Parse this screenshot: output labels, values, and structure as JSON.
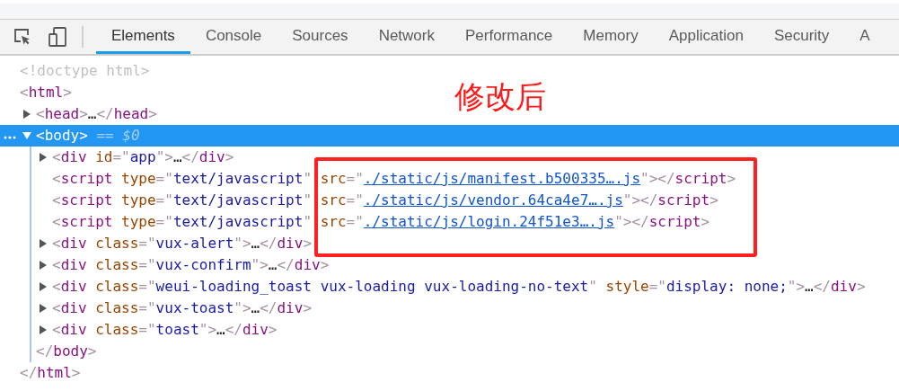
{
  "toolbar": {
    "tabs": [
      {
        "label": "Elements",
        "selected": true
      },
      {
        "label": "Console",
        "selected": false
      },
      {
        "label": "Sources",
        "selected": false
      },
      {
        "label": "Network",
        "selected": false
      },
      {
        "label": "Performance",
        "selected": false
      },
      {
        "label": "Memory",
        "selected": false
      },
      {
        "label": "Application",
        "selected": false
      },
      {
        "label": "Security",
        "selected": false
      },
      {
        "label": "A",
        "selected": false
      }
    ]
  },
  "annotation": "修改后",
  "dom_tree": [
    {
      "kind": "leaf",
      "selected": false,
      "tokens": [
        {
          "kind": "doctype",
          "text": "<!doctype html>"
        }
      ]
    },
    {
      "kind": "leaf",
      "selected": false,
      "tokens": [
        {
          "kind": "bracket",
          "text": "<"
        },
        {
          "kind": "tag",
          "text": "html"
        },
        {
          "kind": "bracket",
          "text": ">"
        }
      ],
      "close": [
        {
          "kind": "bracket",
          "text": "</"
        },
        {
          "kind": "tag",
          "text": "html"
        },
        {
          "kind": "bracket",
          "text": ">"
        }
      ],
      "children": [
        {
          "kind": "branch",
          "expanded": false,
          "selected": false,
          "tokens": [
            {
              "kind": "bracket",
              "text": "<"
            },
            {
              "kind": "tag",
              "text": "head"
            },
            {
              "kind": "bracket",
              "text": ">"
            },
            {
              "kind": "plain",
              "text": "…"
            },
            {
              "kind": "bracket",
              "text": "</"
            },
            {
              "kind": "tag",
              "text": "head"
            },
            {
              "kind": "bracket",
              "text": ">"
            }
          ]
        },
        {
          "kind": "branch",
          "expanded": true,
          "selected": true,
          "tokens": [
            {
              "kind": "bracket",
              "text": "<"
            },
            {
              "kind": "tag",
              "text": "body"
            },
            {
              "kind": "bracket",
              "text": ">"
            },
            {
              "kind": "note",
              "text": " == "
            },
            {
              "kind": "var",
              "text": "$0"
            }
          ],
          "close": [
            {
              "kind": "bracket",
              "text": "</"
            },
            {
              "kind": "tag",
              "text": "body"
            },
            {
              "kind": "bracket",
              "text": ">"
            }
          ],
          "children": [
            {
              "kind": "branch",
              "expanded": false,
              "selected": false,
              "tokens": [
                {
                  "kind": "bracket",
                  "text": "<"
                },
                {
                  "kind": "tag",
                  "text": "div"
                },
                {
                  "kind": "attr",
                  "text": " id"
                },
                {
                  "kind": "bracket",
                  "text": "=\""
                },
                {
                  "kind": "value",
                  "text": "app"
                },
                {
                  "kind": "bracket",
                  "text": "\">"
                },
                {
                  "kind": "plain",
                  "text": "…"
                },
                {
                  "kind": "bracket",
                  "text": "</"
                },
                {
                  "kind": "tag",
                  "text": "div"
                },
                {
                  "kind": "bracket",
                  "text": ">"
                }
              ]
            },
            {
              "kind": "leaf",
              "selected": false,
              "tokens": [
                {
                  "kind": "bracket",
                  "text": "<"
                },
                {
                  "kind": "tag",
                  "text": "script"
                },
                {
                  "kind": "attr",
                  "text": " type"
                },
                {
                  "kind": "bracket",
                  "text": "=\""
                },
                {
                  "kind": "value",
                  "text": "text/javascript"
                },
                {
                  "kind": "bracket",
                  "text": "\""
                },
                {
                  "kind": "attr",
                  "text": " src"
                },
                {
                  "kind": "bracket",
                  "text": "=\""
                },
                {
                  "kind": "link",
                  "text": "./static/js/manifest.b500335….js"
                },
                {
                  "kind": "bracket",
                  "text": "\"></"
                },
                {
                  "kind": "tag",
                  "text": "script"
                },
                {
                  "kind": "bracket",
                  "text": ">"
                }
              ]
            },
            {
              "kind": "leaf",
              "selected": false,
              "tokens": [
                {
                  "kind": "bracket",
                  "text": "<"
                },
                {
                  "kind": "tag",
                  "text": "script"
                },
                {
                  "kind": "attr",
                  "text": " type"
                },
                {
                  "kind": "bracket",
                  "text": "=\""
                },
                {
                  "kind": "value",
                  "text": "text/javascript"
                },
                {
                  "kind": "bracket",
                  "text": "\""
                },
                {
                  "kind": "attr",
                  "text": " src"
                },
                {
                  "kind": "bracket",
                  "text": "=\""
                },
                {
                  "kind": "link",
                  "text": "./static/js/vendor.64ca4e7….js"
                },
                {
                  "kind": "bracket",
                  "text": "\"></"
                },
                {
                  "kind": "tag",
                  "text": "script"
                },
                {
                  "kind": "bracket",
                  "text": ">"
                }
              ]
            },
            {
              "kind": "leaf",
              "selected": false,
              "tokens": [
                {
                  "kind": "bracket",
                  "text": "<"
                },
                {
                  "kind": "tag",
                  "text": "script"
                },
                {
                  "kind": "attr",
                  "text": " type"
                },
                {
                  "kind": "bracket",
                  "text": "=\""
                },
                {
                  "kind": "value",
                  "text": "text/javascript"
                },
                {
                  "kind": "bracket",
                  "text": "\""
                },
                {
                  "kind": "attr",
                  "text": " src"
                },
                {
                  "kind": "bracket",
                  "text": "=\""
                },
                {
                  "kind": "link",
                  "text": "./static/js/login.24f51e3….js"
                },
                {
                  "kind": "bracket",
                  "text": "\"></"
                },
                {
                  "kind": "tag",
                  "text": "script"
                },
                {
                  "kind": "bracket",
                  "text": ">"
                }
              ]
            },
            {
              "kind": "branch",
              "expanded": false,
              "selected": false,
              "tokens": [
                {
                  "kind": "bracket",
                  "text": "<"
                },
                {
                  "kind": "tag",
                  "text": "div"
                },
                {
                  "kind": "attr",
                  "text": " class"
                },
                {
                  "kind": "bracket",
                  "text": "=\""
                },
                {
                  "kind": "value",
                  "text": "vux-alert"
                },
                {
                  "kind": "bracket",
                  "text": "\">"
                },
                {
                  "kind": "plain",
                  "text": "…"
                },
                {
                  "kind": "bracket",
                  "text": "</"
                },
                {
                  "kind": "tag",
                  "text": "div"
                },
                {
                  "kind": "bracket",
                  "text": ">"
                }
              ]
            },
            {
              "kind": "branch",
              "expanded": false,
              "selected": false,
              "tokens": [
                {
                  "kind": "bracket",
                  "text": "<"
                },
                {
                  "kind": "tag",
                  "text": "div"
                },
                {
                  "kind": "attr",
                  "text": " class"
                },
                {
                  "kind": "bracket",
                  "text": "=\""
                },
                {
                  "kind": "value",
                  "text": "vux-confirm"
                },
                {
                  "kind": "bracket",
                  "text": "\">"
                },
                {
                  "kind": "plain",
                  "text": "…"
                },
                {
                  "kind": "bracket",
                  "text": "</"
                },
                {
                  "kind": "tag",
                  "text": "div"
                },
                {
                  "kind": "bracket",
                  "text": ">"
                }
              ]
            },
            {
              "kind": "branch",
              "expanded": false,
              "selected": false,
              "tokens": [
                {
                  "kind": "bracket",
                  "text": "<"
                },
                {
                  "kind": "tag",
                  "text": "div"
                },
                {
                  "kind": "attr",
                  "text": " class"
                },
                {
                  "kind": "bracket",
                  "text": "=\""
                },
                {
                  "kind": "value",
                  "text": "weui-loading_toast vux-loading vux-loading-no-text"
                },
                {
                  "kind": "bracket",
                  "text": "\""
                },
                {
                  "kind": "attr",
                  "text": " style"
                },
                {
                  "kind": "bracket",
                  "text": "=\""
                },
                {
                  "kind": "value",
                  "text": "display: none;"
                },
                {
                  "kind": "bracket",
                  "text": "\">"
                },
                {
                  "kind": "plain",
                  "text": "…"
                },
                {
                  "kind": "bracket",
                  "text": "</"
                },
                {
                  "kind": "tag",
                  "text": "div"
                },
                {
                  "kind": "bracket",
                  "text": ">"
                }
              ]
            },
            {
              "kind": "branch",
              "expanded": false,
              "selected": false,
              "tokens": [
                {
                  "kind": "bracket",
                  "text": "<"
                },
                {
                  "kind": "tag",
                  "text": "div"
                },
                {
                  "kind": "attr",
                  "text": " class"
                },
                {
                  "kind": "bracket",
                  "text": "=\""
                },
                {
                  "kind": "value",
                  "text": "vux-toast"
                },
                {
                  "kind": "bracket",
                  "text": "\">"
                },
                {
                  "kind": "plain",
                  "text": "…"
                },
                {
                  "kind": "bracket",
                  "text": "</"
                },
                {
                  "kind": "tag",
                  "text": "div"
                },
                {
                  "kind": "bracket",
                  "text": ">"
                }
              ]
            },
            {
              "kind": "branch",
              "expanded": false,
              "selected": false,
              "tokens": [
                {
                  "kind": "bracket",
                  "text": "<"
                },
                {
                  "kind": "tag",
                  "text": "div"
                },
                {
                  "kind": "attr",
                  "text": " class"
                },
                {
                  "kind": "bracket",
                  "text": "=\""
                },
                {
                  "kind": "value",
                  "text": "toast"
                },
                {
                  "kind": "bracket",
                  "text": "\">"
                },
                {
                  "kind": "plain",
                  "text": "…"
                },
                {
                  "kind": "bracket",
                  "text": "</"
                },
                {
                  "kind": "tag",
                  "text": "div"
                },
                {
                  "kind": "bracket",
                  "text": ">"
                }
              ]
            }
          ]
        }
      ]
    }
  ]
}
